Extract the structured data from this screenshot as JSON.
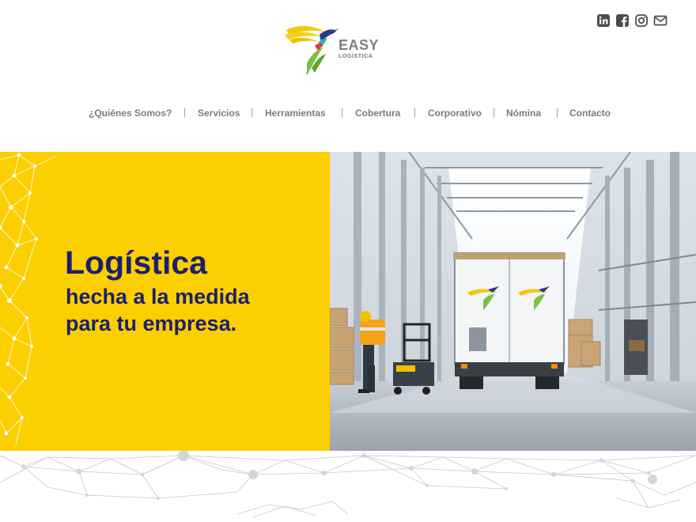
{
  "brand": {
    "name": "EASY",
    "tagline": "LOGÍSTICA"
  },
  "social": [
    {
      "icon": "linkedin-icon"
    },
    {
      "icon": "facebook-icon"
    },
    {
      "icon": "instagram-icon"
    },
    {
      "icon": "mail-icon"
    }
  ],
  "nav": {
    "items": [
      "¿Quiénes Somos?",
      "Servicios",
      "Herramientas",
      "Cobertura",
      "Corporativo",
      "Nómina",
      "Contacto"
    ]
  },
  "hero": {
    "title": "Logística",
    "line1": "hecha a la medida",
    "line2": "para tu empresa."
  },
  "colors": {
    "accent_yellow": "#fccf00",
    "navy": "#1c1f6e",
    "nav_text": "#777b80"
  }
}
